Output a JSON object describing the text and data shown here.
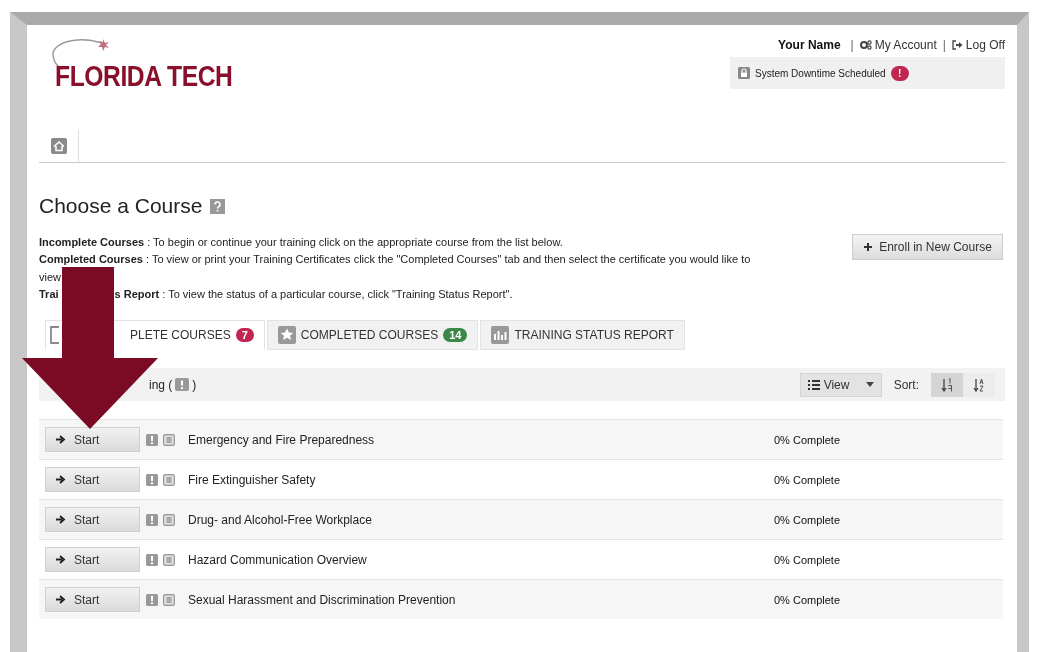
{
  "user": {
    "name": "Your Name",
    "links": [
      {
        "separator": "|",
        "label": "My Account"
      },
      {
        "separator": "|",
        "label": "Log Off"
      }
    ]
  },
  "notice": {
    "text": "System Downtime Scheduled",
    "badge": "!"
  },
  "logo": {
    "text": "FLORIDA TECH"
  },
  "page_title": "Choose a Course",
  "instructions": [
    {
      "parts": [
        "**Incomplete Courses** : To begin or continue your training click on the appropriate course from the list below."
      ]
    },
    {
      "parts": [
        "**Completed Courses** : To view or print your Training Certificates click the \"Completed Courses\" tab and then select the certificate you would like to"
      ]
    },
    {
      "parts": [
        "view"
      ]
    },
    {
      "parts": [
        "**Trai**",
        "**s Report** : To view the status of a particular course, click \"Training Status Report\"."
      ]
    }
  ],
  "enroll_button": "Enroll in New Course",
  "tabs": [
    {
      "label": "PLETE COURSES",
      "count": "7",
      "color": "#c0264f",
      "selected": true
    },
    {
      "label": "COMPLETED COURSES",
      "count": "14",
      "color": "#3a8748",
      "selected": false
    },
    {
      "label": "TRAINING STATUS REPORT",
      "selected": false
    }
  ],
  "list_header": {
    "before": "ing (",
    "after": ")"
  },
  "view_button": "View",
  "sort": {
    "label": "Sort:",
    "options": [
      {
        "selected": true
      },
      {
        "selected": false
      }
    ]
  },
  "courses": [
    {
      "button": "Start",
      "title": "Emergency and Fire Preparedness",
      "progress": "0% Complete"
    },
    {
      "button": "Start",
      "title": "Fire Extinguisher Safety",
      "progress": "0% Complete"
    },
    {
      "button": "Start",
      "title": "Drug- and Alcohol-Free Workplace",
      "progress": "0% Complete"
    },
    {
      "button": "Start",
      "title": "Hazard Communication Overview",
      "progress": "0% Complete"
    },
    {
      "button": "Start",
      "title": "Sexual Harassment and Discrimination Prevention",
      "progress": "0% Complete"
    }
  ]
}
